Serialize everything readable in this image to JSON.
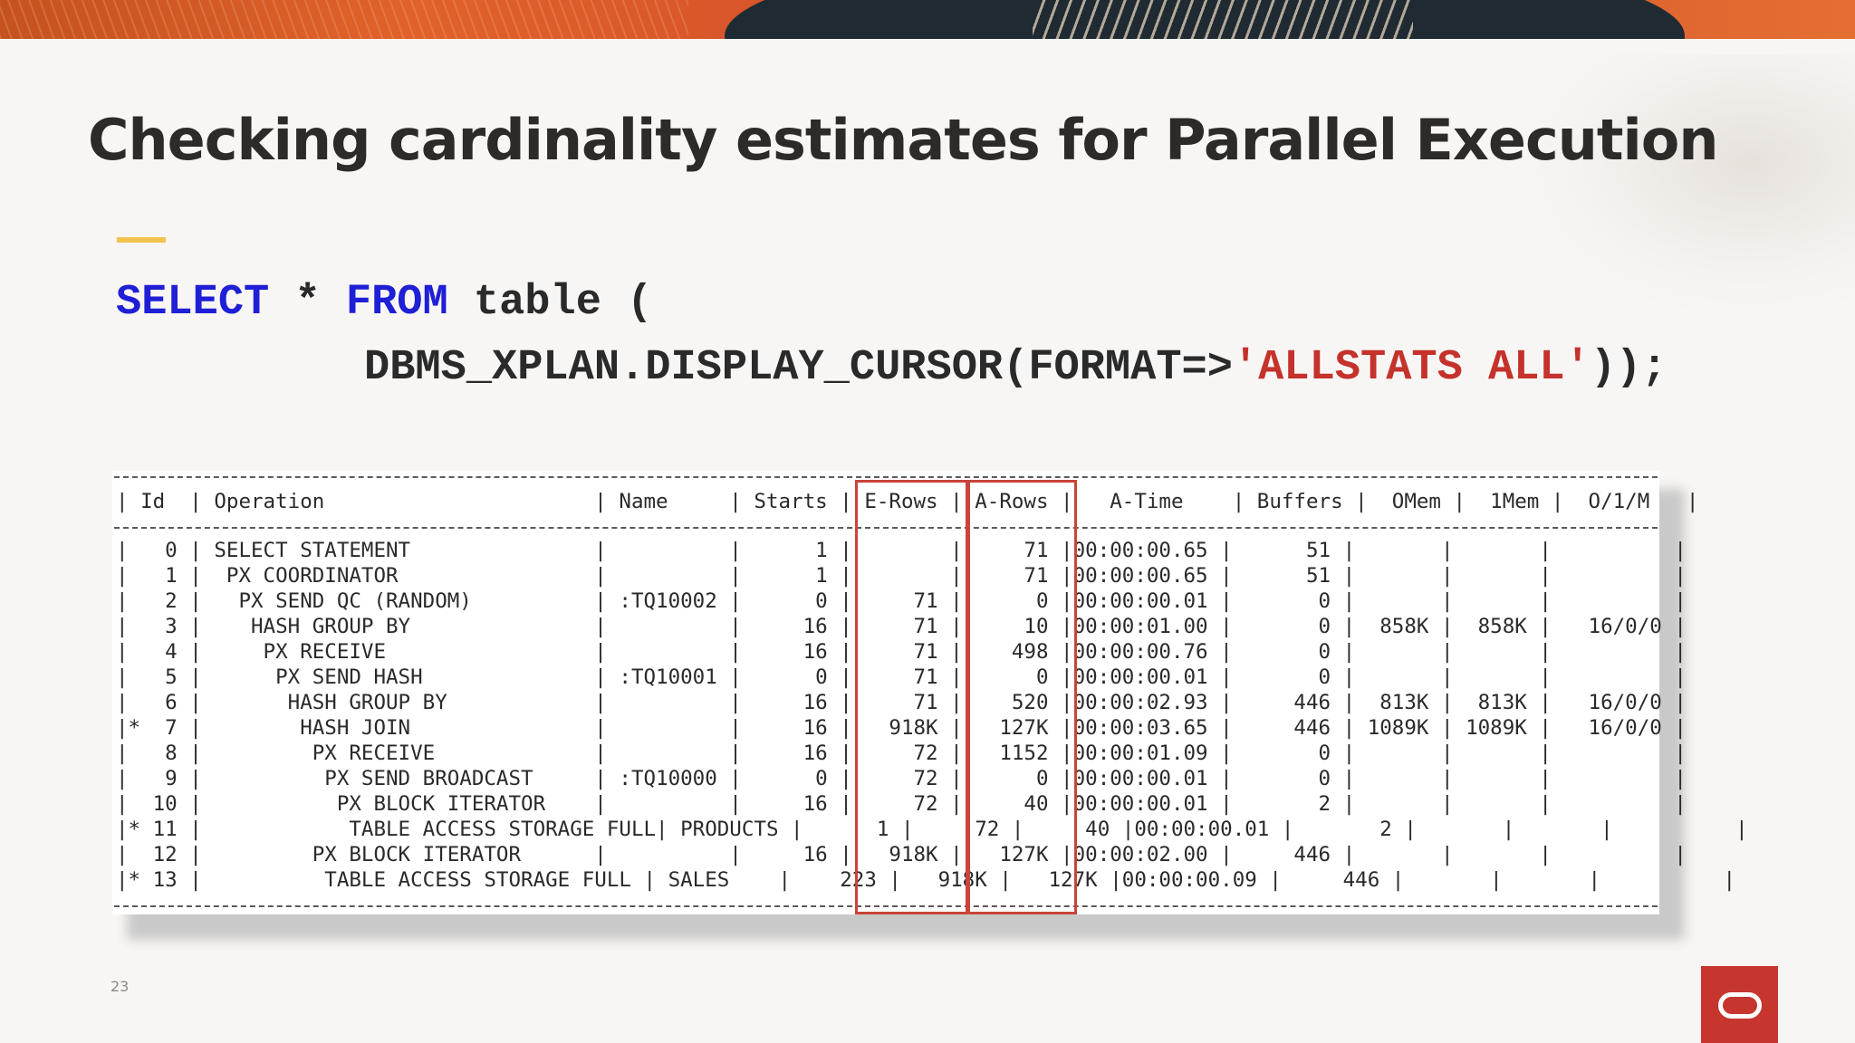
{
  "slide": {
    "title": "Checking cardinality estimates for Parallel Execution",
    "page_number": "23",
    "accent_color": "#f1c24e",
    "logo_icon": "oracle-logo"
  },
  "code": {
    "select_kw": "SELECT",
    "star": " * ",
    "from_kw": "FROM",
    "rest_line1": " table (",
    "line2_prefix": "DBMS_XPLAN.DISPLAY_CURSOR(FORMAT=>",
    "line2_string": "'ALLSTATS ALL'",
    "line2_suffix": "));",
    "keyword_color": "#1f1fd6",
    "string_color": "#c4322b"
  },
  "plan": {
    "header": "| Id  | Operation                      | Name     | Starts | E-Rows | A-Rows |   A-Time    | Buffers |  OMem |  1Mem |  O/1/M   |",
    "rows": [
      "|   0 | SELECT STATEMENT               |          |      1 |        |     71 |00:00:00.65 |      51 |       |       |          |",
      "|   1 |  PX COORDINATOR                |          |      1 |        |     71 |00:00:00.65 |      51 |       |       |          |",
      "|   2 |   PX SEND QC (RANDOM)          | :TQ10002 |      0 |     71 |      0 |00:00:00.01 |       0 |       |       |          |",
      "|   3 |    HASH GROUP BY               |          |     16 |     71 |     10 |00:00:01.00 |       0 |  858K |  858K |   16/0/0 |",
      "|   4 |     PX RECEIVE                 |          |     16 |     71 |    498 |00:00:00.76 |       0 |       |       |          |",
      "|   5 |      PX SEND HASH              | :TQ10001 |      0 |     71 |      0 |00:00:00.01 |       0 |       |       |          |",
      "|   6 |       HASH GROUP BY            |          |     16 |     71 |    520 |00:00:02.93 |     446 |  813K |  813K |   16/0/0 |",
      "|*  7 |        HASH JOIN               |          |     16 |   918K |   127K |00:00:03.65 |     446 | 1089K | 1089K |   16/0/0 |",
      "|   8 |         PX RECEIVE             |          |     16 |     72 |   1152 |00:00:01.09 |       0 |       |       |          |",
      "|   9 |          PX SEND BROADCAST     | :TQ10000 |      0 |     72 |      0 |00:00:00.01 |       0 |       |       |          |",
      "|  10 |           PX BLOCK ITERATOR    |          |     16 |     72 |     40 |00:00:00.01 |       2 |       |       |          |",
      "|* 11 |            TABLE ACCESS STORAGE FULL| PRODUCTS |      1 |     72 |     40 |00:00:00.01 |       2 |       |       |          |",
      "|  12 |         PX BLOCK ITERATOR      |          |     16 |   918K |   127K |00:00:02.00 |     446 |       |       |          |",
      "|* 13 |          TABLE ACCESS STORAGE FULL | SALES    |    223 |   918K |   127K |00:00:00.09 |     446 |       |       |          |"
    ],
    "highlighted_columns": [
      "E-Rows",
      "A-Rows"
    ],
    "highlight_color": "#c9443a"
  }
}
